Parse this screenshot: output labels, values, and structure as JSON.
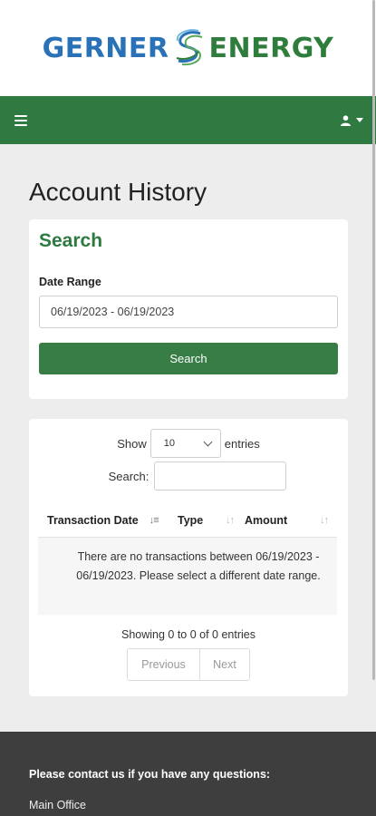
{
  "logo": {
    "left": "GERNER",
    "right": "ENERGY"
  },
  "navbar": {
    "menu_icon": "hamburger-icon",
    "user_icon": "user-icon"
  },
  "page": {
    "title": "Account History"
  },
  "search_panel": {
    "heading": "Search",
    "date_range_label": "Date Range",
    "date_range_value": "06/19/2023 - 06/19/2023",
    "button_label": "Search"
  },
  "table_panel": {
    "show_label": "Show",
    "page_size": "10",
    "entries_label": "entries",
    "search_label": "Search:",
    "columns": [
      "Transaction Date",
      "Type",
      "Amount"
    ],
    "empty_message": "There are no transactions between 06/19/2023 - 06/19/2023. Please select a different date range.",
    "info": "Showing 0 to 0 of 0 entries",
    "pagination": {
      "previous": "Previous",
      "next": "Next"
    }
  },
  "footer": {
    "heading": "Please contact us if you have any questions:",
    "office": "Main Office"
  },
  "colors": {
    "brand_green": "#2f7a41",
    "brand_blue": "#2a72b8",
    "footer_bg": "#3e3e3e"
  }
}
